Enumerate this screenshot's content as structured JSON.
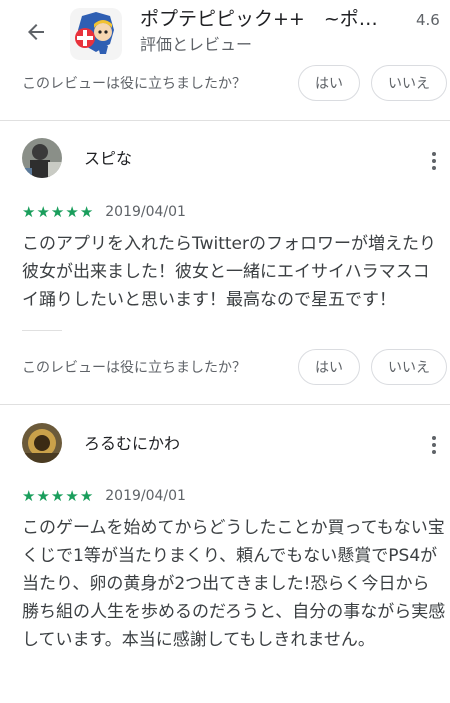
{
  "header": {
    "app_title": "ポプテピピック++　~ポ…",
    "subtitle": "評価とレビュー",
    "rating": "4.6",
    "back_icon": "arrow-back-icon"
  },
  "helpful": {
    "question": "このレビューは役に立ちましたか？",
    "yes_label": "はい",
    "no_label": "いいえ"
  },
  "reviews": [
    {
      "author": "スピな",
      "stars": 5,
      "date": "2019/04/01",
      "text": "このアプリを入れたらTwitterのフォロワーが増えたり彼女が出来ました！彼女と一緒にエイサイハラマスコイ踊りしたいと思います！最高なので星五です！"
    },
    {
      "author": "ろるむにかわ",
      "stars": 5,
      "date": "2019/04/01",
      "text": "このゲームを始めてからどうしたことか買ってもない宝くじで1等が当たりまくり、頼んでもない懸賞でPS4が当たり、卵の黄身が2つ出てきました!恐らく今日から勝ち組の人生を歩めるのだろうと、自分の事ながら実感しています。本当に感謝してもしきれません。"
    }
  ],
  "colors": {
    "star": "#1a9e5c",
    "secondary_text": "#5f6368",
    "divider": "#e0e0e0"
  }
}
